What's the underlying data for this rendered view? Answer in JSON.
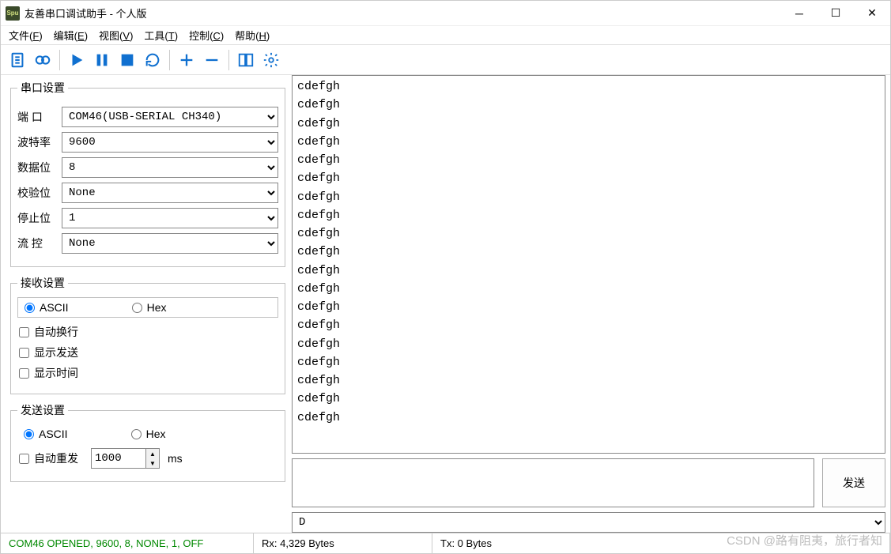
{
  "window": {
    "title": "友善串口调试助手 - 个人版",
    "app_icon_text": "Spu"
  },
  "menu": {
    "file": "文件",
    "file_u": "F",
    "edit": "编辑",
    "edit_u": "E",
    "view": "视图",
    "view_u": "V",
    "tools": "工具",
    "tools_u": "T",
    "control": "控制",
    "control_u": "C",
    "help": "帮助",
    "help_u": "H"
  },
  "toolbar_icons": [
    "document-icon",
    "record-icon",
    "play-icon",
    "pause-icon",
    "stop-icon",
    "refresh-icon",
    "plus-icon",
    "minus-icon",
    "panels-icon",
    "gear-icon"
  ],
  "serial_settings": {
    "legend": "串口设置",
    "port_label": "端 口",
    "baud_label": "波特率",
    "databits_label": "数据位",
    "parity_label": "校验位",
    "stopbits_label": "停止位",
    "flow_label": "流 控",
    "port": "COM46(USB-SERIAL CH340)",
    "baud": "9600",
    "databits": "8",
    "parity": "None",
    "stopbits": "1",
    "flow": "None"
  },
  "recv_settings": {
    "legend": "接收设置",
    "ascii_label": "ASCII",
    "hex_label": "Hex",
    "encoding": "ascii",
    "auto_wrap_label": "自动换行",
    "show_send_label": "显示发送",
    "show_time_label": "显示时间",
    "auto_wrap": false,
    "show_send": false,
    "show_time": false
  },
  "send_settings": {
    "legend": "发送设置",
    "ascii_label": "ASCII",
    "hex_label": "Hex",
    "encoding": "ascii",
    "auto_resend_label": "自动重发",
    "auto_resend": false,
    "resend_interval": "1000",
    "resend_unit": "ms"
  },
  "recv_data": "cdefgh\ncdefgh\ncdefgh\ncdefgh\ncdefgh\ncdefgh\ncdefgh\ncdefgh\ncdefgh\ncdefgh\ncdefgh\ncdefgh\ncdefgh\ncdefgh\ncdefgh\ncdefgh\ncdefgh\ncdefgh\ncdefgh",
  "send_input": "",
  "send_button": "发送",
  "send_combo": "D",
  "status": {
    "port": "COM46 OPENED, 9600, 8, NONE, 1, OFF",
    "rx": "Rx: 4,329 Bytes",
    "tx": "Tx: 0 Bytes"
  },
  "watermark": "CSDN @路有阻夷，旅行者知"
}
